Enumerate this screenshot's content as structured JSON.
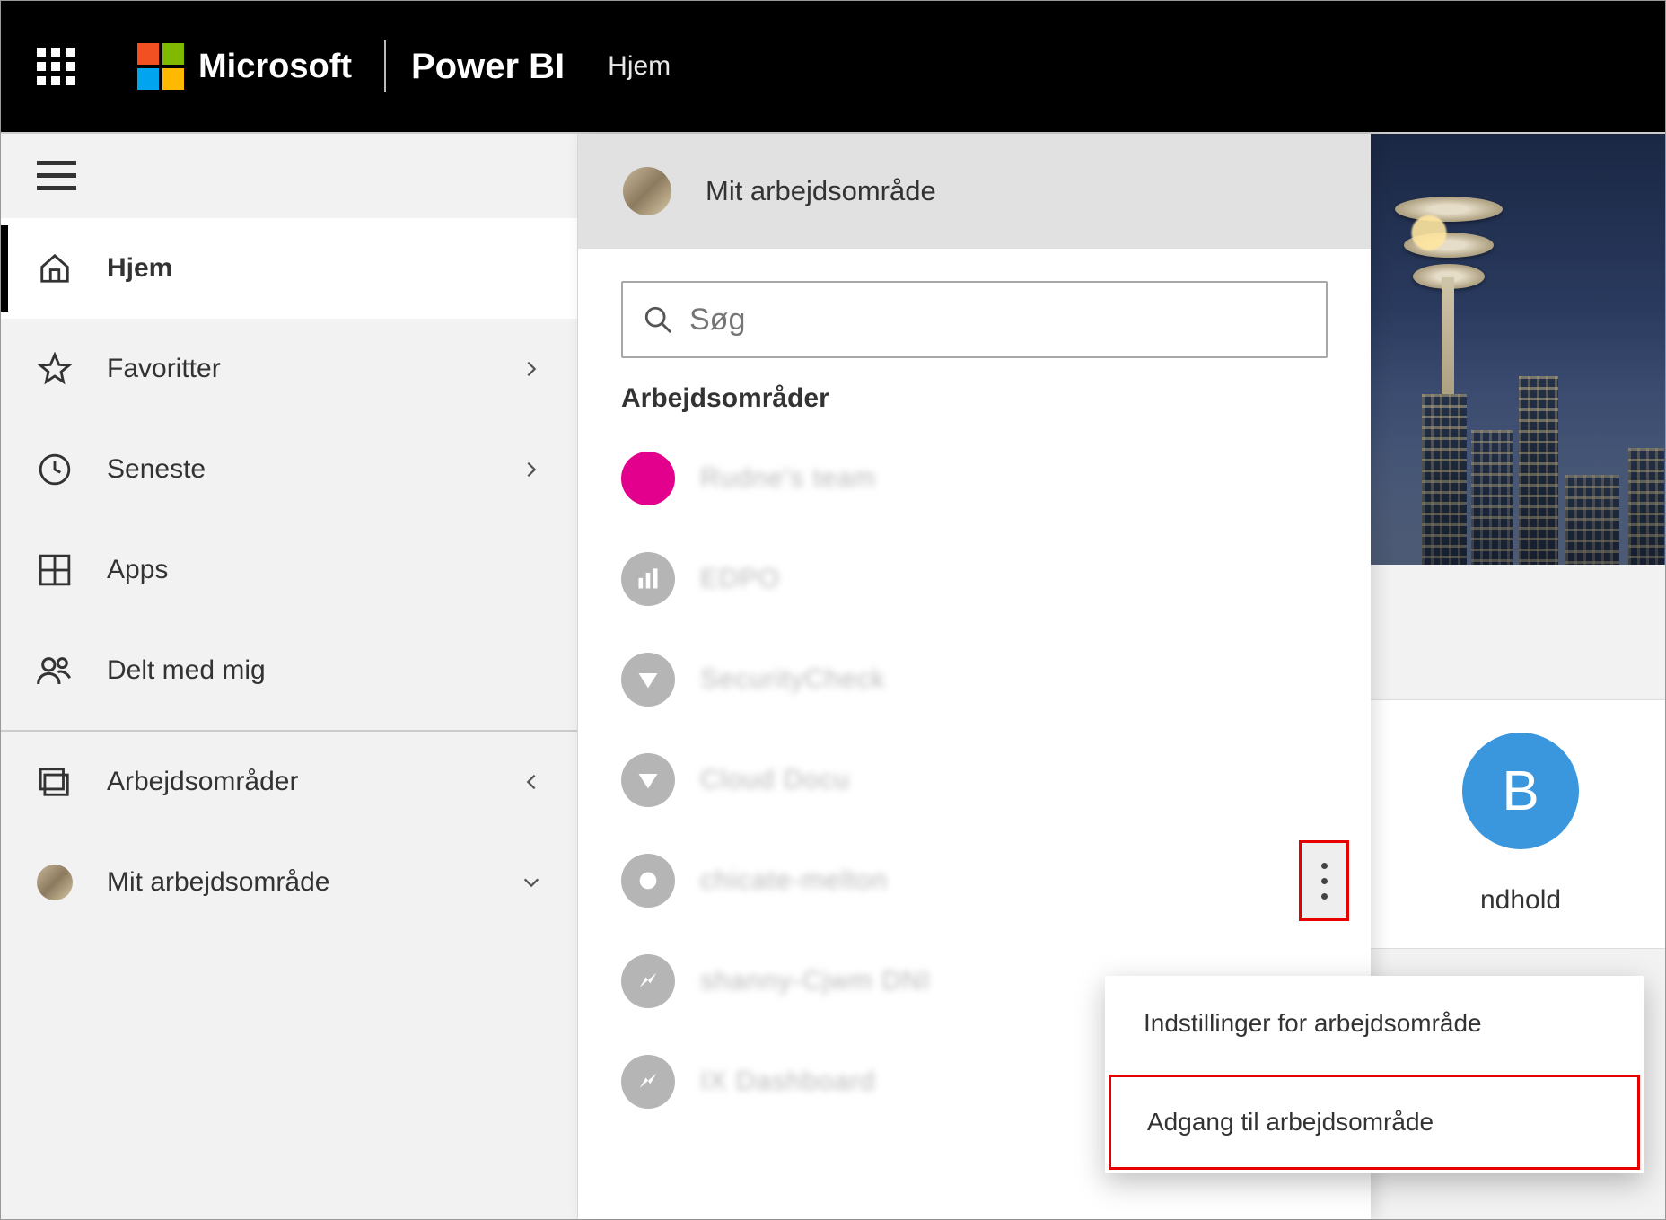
{
  "header": {
    "brand_text": "Microsoft",
    "product_text": "Power BI",
    "page_title": "Hjem"
  },
  "sidebar": {
    "items": [
      {
        "icon": "home",
        "label": "Hjem",
        "active": true,
        "expandable": false
      },
      {
        "icon": "star",
        "label": "Favoritter",
        "active": false,
        "expandable": true
      },
      {
        "icon": "clock",
        "label": "Seneste",
        "active": false,
        "expandable": true
      },
      {
        "icon": "apps",
        "label": "Apps",
        "active": false,
        "expandable": false
      },
      {
        "icon": "shared",
        "label": "Delt med mig",
        "active": false,
        "expandable": false
      }
    ],
    "lower": [
      {
        "icon": "workspaces",
        "label": "Arbejdsområder",
        "chevron": "left"
      },
      {
        "icon": "avatar",
        "label": "Mit arbejdsområde",
        "chevron": "down"
      }
    ]
  },
  "workspace_flyout": {
    "header_label": "Mit arbejdsområde",
    "search_placeholder": "Søg",
    "section_title": "Arbejdsområder",
    "items": [
      {
        "color": "pink",
        "name_masked": true
      },
      {
        "color": "gray",
        "name_masked": true
      },
      {
        "color": "gray",
        "name_masked": true
      },
      {
        "color": "gray",
        "name_masked": true
      },
      {
        "color": "gray",
        "name_masked": true,
        "show_more": true
      },
      {
        "color": "gray",
        "name_masked": true
      },
      {
        "color": "gray",
        "name_masked": true
      }
    ]
  },
  "context_menu": {
    "items": [
      {
        "label": "Indstillinger for arbejdsområde",
        "highlight": false
      },
      {
        "label": "Adgang til arbejdsområde",
        "highlight": true
      }
    ]
  },
  "content_behind": {
    "tile_letter": "B",
    "tile_label_partial": "ndhold"
  }
}
